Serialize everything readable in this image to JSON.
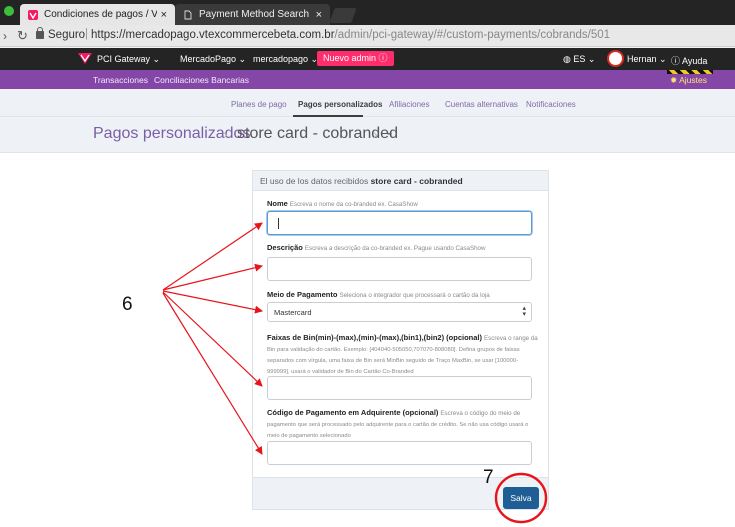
{
  "browser": {
    "tabs": [
      {
        "label": "Condiciones de pagos / VTEX",
        "close": "×"
      },
      {
        "label": "Payment Method Search",
        "close": "×"
      }
    ],
    "secure_label": "Seguro",
    "url_host": "https://mercadopago.vtexcommercebeta.com.br",
    "url_path": "/admin/pci-gateway/#/custom-payments/cobrands/501"
  },
  "topnav": {
    "product": "PCI Gateway",
    "account1": "MercadoPago",
    "account2": "mercadopago",
    "new_admin": "Nuevo admin",
    "language": "ES",
    "user": "Hernan",
    "help": "Ayuda"
  },
  "subnav": {
    "items": [
      "Transacciones",
      "Conciliaciones Bancarias"
    ],
    "settings": "Ajustes"
  },
  "tabs": [
    "Planes de pago",
    "Pagos personalizados",
    "Afiliaciones",
    "Cuentas alternativas",
    "Notificaciones"
  ],
  "breadcrumb": {
    "root": "Pagos personalizados",
    "section": "store card - cobranded",
    "current": "-"
  },
  "form": {
    "header_prefix": "El uso de los datos recibidos",
    "header_bold": "store card - cobranded",
    "name_label": "Nome",
    "name_hint": "Escreva o nome da co-branded ex. CasaShow",
    "desc_label": "Descrição",
    "desc_hint": "Escreva a descrição da co-branded ex. Pague usando CasaShow",
    "payment_label": "Meio de Pagamento",
    "payment_hint": "Seleciona o integrador que processará o cartão da loja",
    "payment_value": "Mastercard",
    "bins_label": "Faixas de Bin(min)-(max),(min)-(max),(bin1),(bin2) (opcional)",
    "bins_hint": "Escreva o range da",
    "bins_help": "Bin para validação do cartão. Exemplo: [404040-505050,707070-808080]. Defina grupos de faixas separados com vírgula, uma faixa de Bin será MinBin seguido de Traço MaxBin, se usar [100000-999999], usará o validador de Bin do Cartão Co-Branded",
    "code_label": "Código de Pagamento em Adquirente (opcional)",
    "code_hint": "Escreva o código do meio de",
    "code_help": "pagamento que será processado pelo adquirente para o cartão de crédito. Se não usa código usará o meio de pagamento selecionado",
    "save": "Salva"
  },
  "annotations": {
    "label_fields": "6",
    "label_save": "7",
    "color": "#e8141b"
  }
}
